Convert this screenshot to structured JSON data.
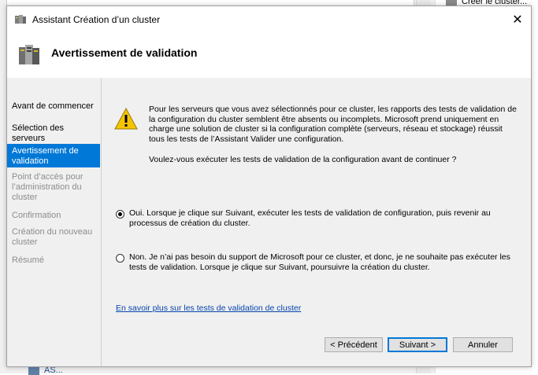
{
  "background": {
    "top_action_label": "Créer le cluster...",
    "bottom_item_label": "AS..."
  },
  "dialog": {
    "title": "Assistant Création d’un cluster",
    "close_glyph": "✕",
    "header_title": "Avertissement de validation"
  },
  "sidebar": {
    "items": [
      {
        "label": "Avant de commencer",
        "state": "normal"
      },
      {
        "label": "Sélection des serveurs",
        "state": "normal"
      },
      {
        "label": "Avertissement de validation",
        "state": "active"
      },
      {
        "label": "Point d’accès pour l’administration du cluster",
        "state": "disabled"
      },
      {
        "label": "Confirmation",
        "state": "disabled"
      },
      {
        "label": "Création du nouveau cluster",
        "state": "disabled"
      },
      {
        "label": "Résumé",
        "state": "disabled"
      }
    ]
  },
  "content": {
    "warning_text": "Pour les serveurs que vous avez sélectionnés pour ce cluster, les rapports des tests de validation de la configuration du cluster semblent être absents ou incomplets. Microsoft prend uniquement en charge une solution de cluster si la configuration complète (serveurs, réseau et stockage) réussit tous les tests de l’Assistant Valider une configuration.",
    "question": "Voulez-vous exécuter les tests de validation de la configuration avant de continuer ?",
    "option_yes": "Oui. Lorsque je clique sur Suivant, exécuter les tests de validation de configuration, puis revenir au processus de création du cluster.",
    "option_no": "Non. Je n’ai pas besoin du support de Microsoft pour ce cluster, et donc, je ne souhaite pas exécuter les tests de validation. Lorsque je clique sur Suivant, poursuivre la création du cluster.",
    "selected_option": "yes",
    "learn_more_link": "En savoir plus sur les tests de validation de cluster"
  },
  "buttons": {
    "previous": "< Précédent",
    "next": "Suivant >",
    "cancel": "Annuler"
  },
  "colors": {
    "accent": "#0078d7",
    "link": "#0645ad",
    "warning": "#f5c400"
  }
}
